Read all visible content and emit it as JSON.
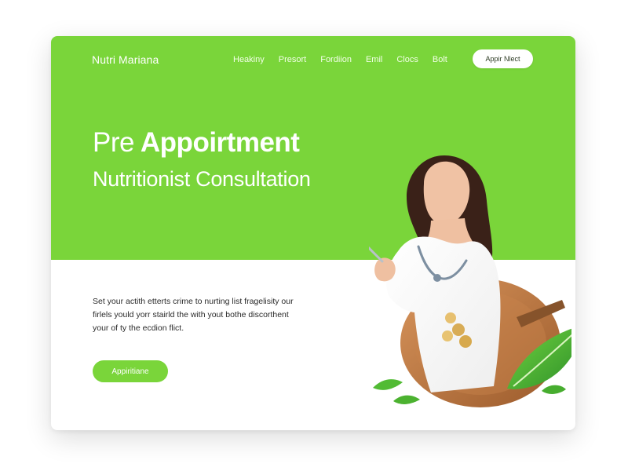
{
  "brand": {
    "name": "Nutri Mariana"
  },
  "nav": {
    "items": [
      {
        "label": "Heakiny"
      },
      {
        "label": "Presort"
      },
      {
        "label": "Fordiion"
      },
      {
        "label": "Emil"
      },
      {
        "label": "Clocs"
      },
      {
        "label": "Bolt"
      }
    ],
    "cta_label": "Appir Nlect"
  },
  "hero": {
    "headline_prefix": "Pre",
    "headline_bold": "Appoirtment",
    "subheadline": "Nutritionist Consultation"
  },
  "content": {
    "paragraph": "Set your actith etterts crime to nurting list fragelisity our firlels yould yorr stairld the with yout bothe discorthent your of ty the ecdion flict.",
    "button_label": "Appiritiane"
  },
  "colors": {
    "brand_green": "#7ad53a",
    "hero_white": "#ffffff",
    "text_dark": "#2a2a2a"
  },
  "icons": {
    "hero_image": "nutritionist-illustration",
    "leaf": "leaf-icon",
    "bowl": "bowl-icon",
    "utensil": "utensil-icon"
  }
}
